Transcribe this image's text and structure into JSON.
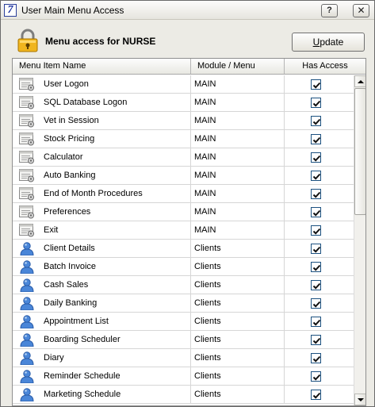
{
  "window": {
    "title": "User Main Menu Access",
    "app_icon_glyph": "7",
    "help_label": "?",
    "close_label": "✕"
  },
  "header": {
    "title": "Menu access for NURSE",
    "icon": "padlock-icon",
    "update_label_first": "U",
    "update_label_rest": "pdate"
  },
  "grid": {
    "columns": [
      "Menu Item Name",
      "Module / Menu",
      "Has Access"
    ],
    "rows": [
      {
        "name": "User Logon",
        "module": "MAIN",
        "access": true,
        "icon": "menu-form-icon"
      },
      {
        "name": "SQL Database Logon",
        "module": "MAIN",
        "access": true,
        "icon": "menu-form-icon"
      },
      {
        "name": "Vet in Session",
        "module": "MAIN",
        "access": true,
        "icon": "menu-form-icon"
      },
      {
        "name": "Stock Pricing",
        "module": "MAIN",
        "access": true,
        "icon": "menu-form-icon"
      },
      {
        "name": "Calculator",
        "module": "MAIN",
        "access": true,
        "icon": "menu-form-icon"
      },
      {
        "name": "Auto Banking",
        "module": "MAIN",
        "access": true,
        "icon": "menu-form-icon"
      },
      {
        "name": "End of Month Procedures",
        "module": "MAIN",
        "access": true,
        "icon": "menu-form-icon"
      },
      {
        "name": "Preferences",
        "module": "MAIN",
        "access": true,
        "icon": "menu-form-icon"
      },
      {
        "name": "Exit",
        "module": "MAIN",
        "access": true,
        "icon": "menu-form-icon"
      },
      {
        "name": "Client Details",
        "module": "Clients",
        "access": true,
        "icon": "person-icon"
      },
      {
        "name": "Batch Invoice",
        "module": "Clients",
        "access": true,
        "icon": "person-icon"
      },
      {
        "name": "Cash Sales",
        "module": "Clients",
        "access": true,
        "icon": "person-icon"
      },
      {
        "name": "Daily Banking",
        "module": "Clients",
        "access": true,
        "icon": "person-icon"
      },
      {
        "name": "Appointment List",
        "module": "Clients",
        "access": true,
        "icon": "person-icon"
      },
      {
        "name": "Boarding Scheduler",
        "module": "Clients",
        "access": true,
        "icon": "person-icon"
      },
      {
        "name": "Diary",
        "module": "Clients",
        "access": true,
        "icon": "person-icon"
      },
      {
        "name": "Reminder Schedule",
        "module": "Clients",
        "access": true,
        "icon": "person-icon"
      },
      {
        "name": "Marketing Schedule",
        "module": "Clients",
        "access": true,
        "icon": "person-icon"
      }
    ]
  },
  "colors": {
    "checkbox_border": "#1c5180",
    "person_icon": "#4a86d8",
    "padlock_body": "#f0b51e"
  }
}
